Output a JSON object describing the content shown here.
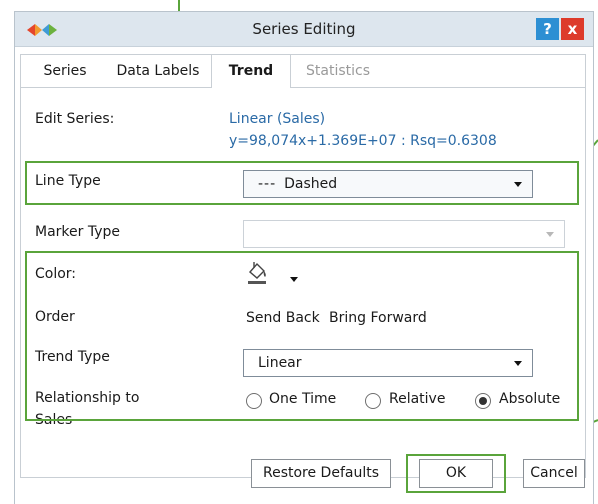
{
  "dialog": {
    "title": "Series Editing",
    "help_label": "?",
    "close_label": "x"
  },
  "tabs": [
    {
      "label": "Series",
      "state": "normal"
    },
    {
      "label": "Data Labels",
      "state": "normal"
    },
    {
      "label": "Trend",
      "state": "active"
    },
    {
      "label": "Statistics",
      "state": "disabled"
    }
  ],
  "form": {
    "edit_series_label": "Edit Series:",
    "series_name": "Linear (Sales)",
    "series_equation": "y=98,074x+1.369E+07 : Rsq=0.6308",
    "line_type_label": "Line Type",
    "line_type_glyph": "---",
    "line_type_value": "Dashed",
    "marker_type_label": "Marker Type",
    "marker_type_value": "",
    "color_label": "Color:",
    "color_icon": "paint-bucket-icon",
    "order_label": "Order",
    "send_back_label": "Send Back",
    "bring_forward_label": "Bring Forward",
    "trend_type_label": "Trend Type",
    "trend_type_value": "Linear",
    "relationship_label_line1": "Relationship to",
    "relationship_label_line2": "Sales",
    "relationship_options": [
      {
        "label": "One Time",
        "checked": false
      },
      {
        "label": "Relative",
        "checked": false
      },
      {
        "label": "Absolute",
        "checked": true
      }
    ]
  },
  "buttons": {
    "restore_defaults": "Restore Defaults",
    "ok": "OK",
    "cancel": "Cancel"
  },
  "colors": {
    "annotation_green": "#5aa43b",
    "link_blue": "#2a6aa6",
    "help_blue": "#2d8fd3",
    "close_red": "#dd3b2b"
  }
}
